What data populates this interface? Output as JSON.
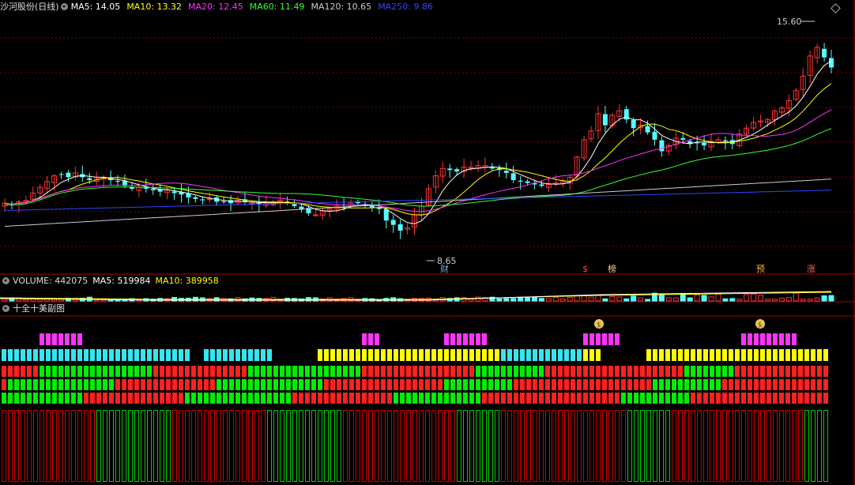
{
  "main_header": {
    "title": "沙河股份(日线)",
    "ma5": "MA5: 14.05",
    "ma10": "MA10: 13.32",
    "ma20": "MA20: 12.45",
    "ma60": "MA60: 11.49",
    "ma120": "MA120: 10.65",
    "ma250": "MA250: 9.86"
  },
  "volume_header": {
    "label": "VOLUME: 442075",
    "ma5": "MA5: 519984",
    "ma10": "MA10: 389958"
  },
  "indicator_header": {
    "label": "十全十美副图"
  },
  "colors": {
    "background": "#000000",
    "grid": "#7a0000",
    "ma5": "#ffffff",
    "ma10": "#ffff00",
    "ma20": "#ff33ff",
    "ma60": "#33ff33",
    "ma120": "#cccccc",
    "ma250": "#3344ff",
    "up": "#ff3232",
    "down": "#54ffff",
    "magenta": "#ff33ff",
    "yellow": "#ffff00",
    "cyan": "#33e6f0",
    "green": "#00ee00",
    "red": "#ff2020"
  },
  "annotations": {
    "high": "15.60",
    "low": "8.65",
    "markers": [
      "财",
      "$",
      "榜",
      "预",
      "涨"
    ]
  },
  "chart_data": {
    "type": "candlestick",
    "title": "沙河股份(日线)",
    "xlabel": "",
    "ylabel": "",
    "ylim": [
      7.4,
      16.4
    ],
    "high": 15.6,
    "low": 8.65,
    "ma_values": {
      "MA5": 14.05,
      "MA10": 13.32,
      "MA20": 12.45,
      "MA60": 11.49,
      "MA120": 10.65,
      "MA250": 9.86
    },
    "close_series": [
      9.8,
      9.75,
      9.85,
      9.9,
      10.15,
      10.35,
      10.55,
      10.75,
      10.8,
      10.7,
      10.85,
      10.7,
      10.6,
      10.65,
      10.7,
      10.6,
      10.55,
      10.4,
      10.3,
      10.35,
      10.3,
      10.25,
      10.2,
      10.25,
      10.15,
      10.1,
      10.0,
      9.95,
      9.9,
      9.95,
      9.85,
      9.85,
      9.8,
      9.9,
      9.85,
      9.8,
      9.75,
      9.8,
      9.85,
      9.9,
      9.8,
      9.7,
      9.6,
      9.45,
      9.4,
      9.55,
      9.6,
      9.7,
      9.75,
      9.8,
      9.8,
      9.7,
      9.65,
      9.6,
      9.2,
      9.05,
      8.85,
      8.95,
      9.4,
      9.7,
      10.3,
      10.75,
      11.0,
      10.95,
      10.9,
      11.05,
      11.05,
      11.1,
      11.1,
      11.0,
      10.95,
      10.85,
      10.6,
      10.55,
      10.5,
      10.45,
      10.4,
      10.45,
      10.5,
      10.55,
      10.7,
      11.4,
      12.0,
      12.3,
      12.9,
      12.5,
      12.85,
      13.0,
      12.7,
      12.4,
      12.5,
      12.25,
      12.0,
      11.6,
      11.8,
      12.05,
      12.0,
      11.85,
      11.9,
      11.8,
      11.95,
      12.0,
      11.95,
      11.85,
      12.2,
      12.4,
      12.6,
      12.65,
      12.7,
      13.0,
      13.1,
      13.35,
      13.7,
      14.2,
      14.9,
      15.2,
      14.85,
      14.5
    ]
  }
}
